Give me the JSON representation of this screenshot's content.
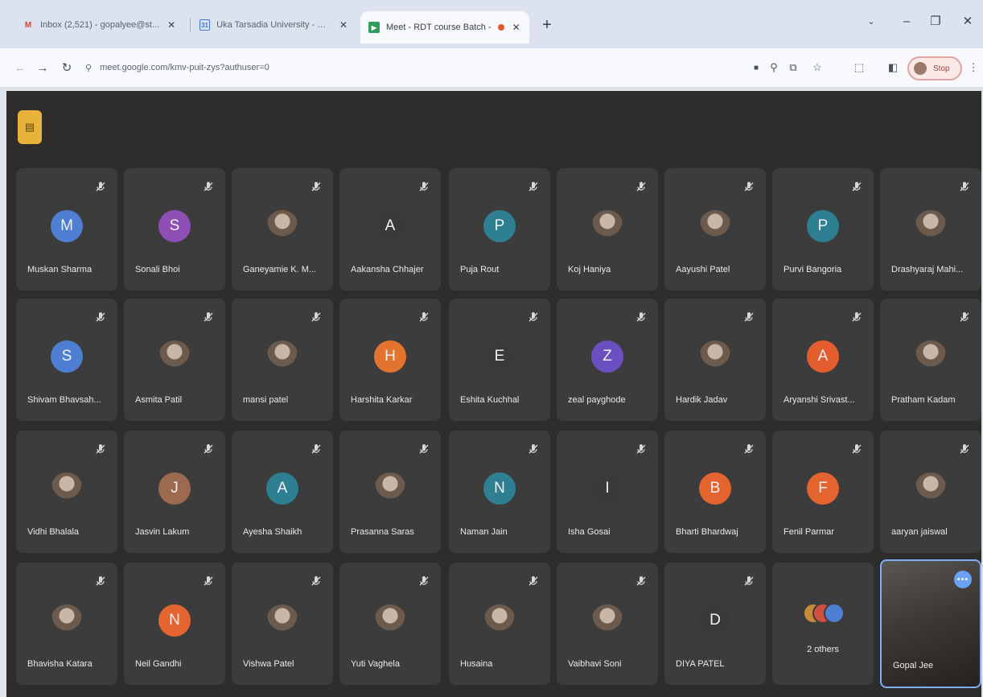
{
  "browser": {
    "tabs": [
      {
        "title": "Inbox (2,521) - gopalyee@st...",
        "icon": "gmail-icon",
        "active": false
      },
      {
        "title": "Uka Tarsadia University - Calen",
        "icon": "calendar-icon",
        "active": false
      },
      {
        "title": "Meet - RDT course Batch -",
        "icon": "meet-icon",
        "active": true
      }
    ],
    "new_tab_label": "+",
    "url": "meet.google.com/kmv-puit-zys?authuser=0",
    "profile_label": "Stop"
  },
  "meeting": {
    "participants": [
      {
        "name": "Muskan Sharma",
        "initial": "M",
        "color": "#4f7fd2"
      },
      {
        "name": "Sonali Bhoi",
        "initial": "S",
        "color": "#8e4fb7"
      },
      {
        "name": "Ganeyamie K. M...",
        "initial": "",
        "color": "photo"
      },
      {
        "name": "Aakansha Chhajer",
        "initial": "A",
        "color": "#3a3a3a"
      },
      {
        "name": "Puja Rout",
        "initial": "P",
        "color": "#2f7f93"
      },
      {
        "name": "Koj Haniya",
        "initial": "",
        "color": "photo"
      },
      {
        "name": "Aayushi Patel",
        "initial": "",
        "color": "photo"
      },
      {
        "name": "Purvi Bangoria",
        "initial": "P",
        "color": "#2f7f93"
      },
      {
        "name": "Drashyaraj Mahi...",
        "initial": "",
        "color": "photo"
      },
      {
        "name": "Shivam Bhavsah...",
        "initial": "S",
        "color": "#4f7fd2"
      },
      {
        "name": "Asmita Patil",
        "initial": "",
        "color": "photo"
      },
      {
        "name": "mansi patel",
        "initial": "",
        "color": "photo"
      },
      {
        "name": "Harshita Karkar",
        "initial": "H",
        "color": "#e3742f"
      },
      {
        "name": "Eshita Kuchhal",
        "initial": "E",
        "color": "#3a3a3a"
      },
      {
        "name": "zeal payghode",
        "initial": "Z",
        "color": "#6a4fc0"
      },
      {
        "name": "Hardik Jadav",
        "initial": "",
        "color": "photo"
      },
      {
        "name": "Aryanshi Srivast...",
        "initial": "A",
        "color": "#e35d2f"
      },
      {
        "name": "Pratham Kadam",
        "initial": "",
        "color": "photo"
      },
      {
        "name": "Vidhi Bhalala",
        "initial": "",
        "color": "photo"
      },
      {
        "name": "Jasvin Lakum",
        "initial": "J",
        "color": "#9b6a4f"
      },
      {
        "name": "Ayesha Shaikh",
        "initial": "A",
        "color": "#2f7f93"
      },
      {
        "name": "Prasanna Saras",
        "initial": "",
        "color": "photo"
      },
      {
        "name": "Naman Jain",
        "initial": "N",
        "color": "#2f7f93"
      },
      {
        "name": "Isha Gosai",
        "initial": "I",
        "color": "#3a3a3a"
      },
      {
        "name": "Bharti Bhardwaj",
        "initial": "B",
        "color": "#e3642f"
      },
      {
        "name": "Fenil Parmar",
        "initial": "F",
        "color": "#e3642f"
      },
      {
        "name": "aaryan jaiswal",
        "initial": "",
        "color": "photo"
      },
      {
        "name": "Bhavisha Katara",
        "initial": "",
        "color": "photo"
      },
      {
        "name": "Neil Gandhi",
        "initial": "N",
        "color": "#e3642f"
      },
      {
        "name": "Vishwa Patel",
        "initial": "",
        "color": "photo"
      },
      {
        "name": "Yuti Vaghela",
        "initial": "",
        "color": "photo"
      },
      {
        "name": "Husaina",
        "initial": "",
        "color": "photo"
      },
      {
        "name": "Vaibhavi Soni",
        "initial": "",
        "color": "photo"
      },
      {
        "name": "DIYA PATEL",
        "initial": "D",
        "color": "#3a3a3a"
      }
    ],
    "others_label": "2 others",
    "self_name": "Gopal Jee",
    "accent": "#7eaef5",
    "tile_bg": "#3c3c3c",
    "stage_bg": "#2f2d2c"
  }
}
